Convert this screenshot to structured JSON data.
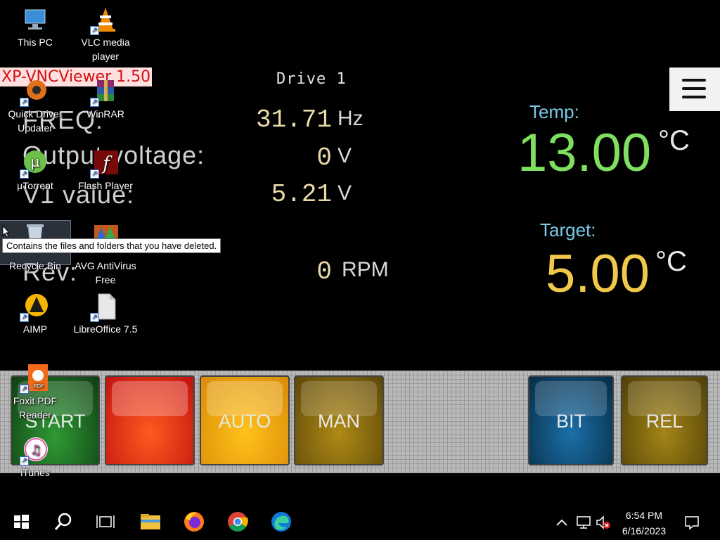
{
  "vnc": {
    "window_title": "XP-VNCViewer 1.50"
  },
  "hmi": {
    "title": "Drive 1",
    "freq": {
      "label": "FREQ:",
      "value": "31.71",
      "unit": "Hz"
    },
    "output_voltage": {
      "label": "Output voltage:",
      "value": "0",
      "unit": "V"
    },
    "v1": {
      "label": "V1 value:",
      "value": "5.21",
      "unit": "V"
    },
    "rev": {
      "label": "Rev:",
      "value": "0",
      "unit": "RPM"
    },
    "temp": {
      "label": "Temp:",
      "value": "13.00",
      "unit": "°C",
      "color": "#7ee05e"
    },
    "target": {
      "label": "Target:",
      "value": "5.00",
      "unit": "°C",
      "color": "#f1c84a"
    },
    "buttons": [
      {
        "label": "START",
        "color": "#1e6b23"
      },
      {
        "label": "",
        "color": "#e2231a"
      },
      {
        "label": "AUTO",
        "color": "#f2a30f"
      },
      {
        "label": "MAN",
        "color": "#8a6a10"
      },
      {
        "label": "BIT",
        "color": "#0d4f7a"
      },
      {
        "label": "REL",
        "color": "#7d6410"
      }
    ],
    "menu_icon": "hamburger-menu-icon"
  },
  "desktop": {
    "icons": [
      {
        "label": "This PC",
        "icon": "computer-icon"
      },
      {
        "label": "VLC media player",
        "icon": "vlc-cone-icon"
      },
      {
        "label": "Quick Driver Updater",
        "icon": "driver-updater-icon"
      },
      {
        "label": "WinRAR",
        "icon": "winrar-books-icon"
      },
      {
        "label": "µTorrent",
        "icon": "utorrent-icon"
      },
      {
        "label": "Flash Player",
        "icon": "flash-icon"
      },
      {
        "label": "Recycle Bin",
        "icon": "recycle-bin-icon"
      },
      {
        "label": "AVG AntiVirus Free",
        "icon": "avg-icon"
      },
      {
        "label": "AIMP",
        "icon": "aimp-icon"
      },
      {
        "label": "LibreOffice 7.5",
        "icon": "libreoffice-icon"
      },
      {
        "label": "Foxit PDF Reader",
        "icon": "foxit-icon"
      },
      {
        "label": "iTunes",
        "icon": "itunes-icon"
      }
    ],
    "tooltip": "Contains the files and folders that you have deleted."
  },
  "taskbar": {
    "time": "6:54 PM",
    "date": "6/16/2023",
    "apps": [
      "start-icon",
      "search-icon",
      "task-view-icon",
      "file-explorer-icon",
      "firefox-icon",
      "chrome-icon",
      "edge-icon"
    ]
  }
}
